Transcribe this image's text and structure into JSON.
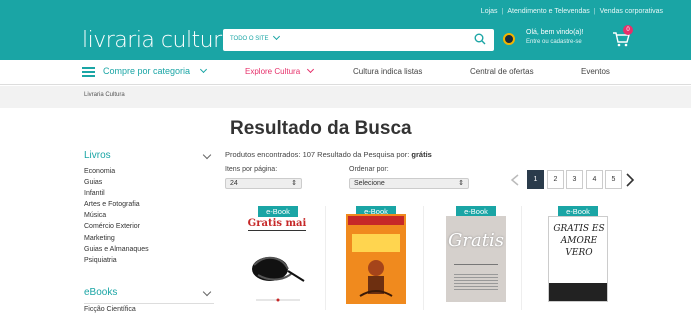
{
  "toplinks": [
    "Lojas",
    "Atendimento e Televendas",
    "Vendas corporativas"
  ],
  "logo": "livraria cultura",
  "search": {
    "scope": "TODO O SITE",
    "scope_arrow": "⌄"
  },
  "login": {
    "line1": "Olá, bem vindo(a)!",
    "line2": "Entre ou cadastre-se"
  },
  "cart": {
    "count": "0"
  },
  "nav": {
    "category": "Compre por categoria",
    "items": [
      "Explore Cultura",
      "Cultura indica listas",
      "Central de ofertas",
      "Eventos"
    ]
  },
  "breadcrumb": "Livraria Cultura",
  "page_title": "Resultado da Busca",
  "results": {
    "found_label": "Produtos encontrados:",
    "found_count": "107",
    "query_label": "Resultado da Pesquisa por:",
    "query": "grátis"
  },
  "controls": {
    "per_page_label": "Itens por página:",
    "per_page_value": "24",
    "order_label": "Ordenar por:",
    "order_value": "Selecione"
  },
  "pagination": {
    "pages": [
      "1",
      "2",
      "3",
      "4",
      "5"
    ],
    "active": "1"
  },
  "sidebar": {
    "livros_title": "Livros",
    "livros_items": [
      "Economia",
      "Guias",
      "Infantil",
      "Artes e Fotografia",
      "Música",
      "Comércio Exterior",
      "Marketing",
      "Guias e Almanaques",
      "Psiquiatria"
    ],
    "ebooks_title": "eBooks",
    "ebooks_items": [
      "Ficção Científica"
    ]
  },
  "products": [
    {
      "badge": "e-Book",
      "cover_title": "Gratis mai"
    },
    {
      "badge": "e-Book",
      "cover_title": ""
    },
    {
      "badge": "e-Book",
      "cover_title": "Gratis"
    },
    {
      "badge": "e-Book",
      "cover_title": "GRATIS ES AMORE VERO"
    }
  ],
  "colors": {
    "brand": "#1aa5a5",
    "accent": "#e6306a",
    "dark": "#2a3b4b"
  }
}
